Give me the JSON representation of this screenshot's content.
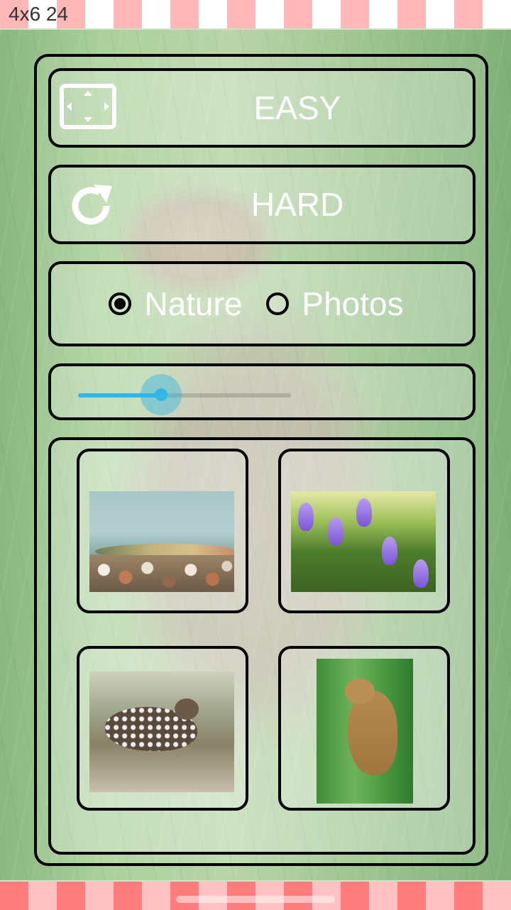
{
  "status": {
    "grid_label": "4x6 24"
  },
  "buttons": {
    "easy_label": "EASY",
    "hard_label": "HARD"
  },
  "category": {
    "options": [
      {
        "label": "Nature",
        "selected": true
      },
      {
        "label": "Photos",
        "selected": false
      }
    ]
  },
  "slider": {
    "value_fraction": 0.39,
    "accent": "#33b5e5"
  },
  "gallery": {
    "items": [
      {
        "icon": "fish-thumbnail"
      },
      {
        "icon": "crocus-flowers-thumbnail"
      },
      {
        "icon": "grouse-thumbnail"
      },
      {
        "icon": "corncrake-thumbnail"
      }
    ]
  },
  "colors": {
    "stripe_top": [
      "#ffb7b7",
      "#ffffff"
    ],
    "stripe_bottom": [
      "#ff7c7c",
      "#ffc1c1"
    ],
    "panel_border": "#000000",
    "text": "#ffffff"
  }
}
